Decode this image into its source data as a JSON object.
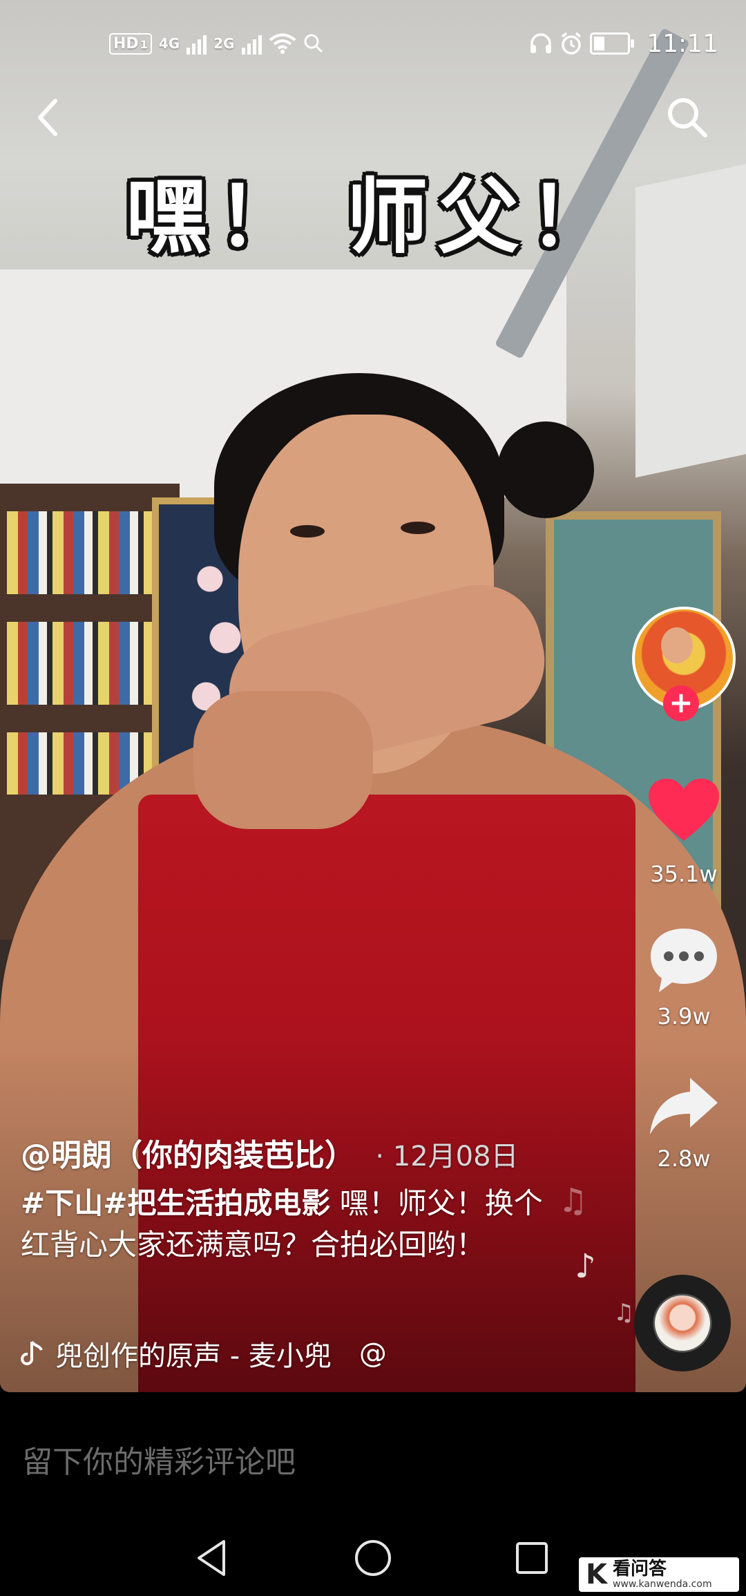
{
  "status_bar": {
    "hd_badge": "HD",
    "hd_sub": "1",
    "net1": "4G",
    "net2": "2G",
    "time": "11:11",
    "battery_level": 0.35
  },
  "video": {
    "caption": "嘿！ 师父！"
  },
  "sidebar": {
    "likes": "35.1w",
    "comments": "3.9w",
    "shares": "2.8w"
  },
  "post": {
    "author": "@明朗（你的肉装芭比）",
    "date": "· 12月08日",
    "hashtags": "#下山#把生活拍成电影",
    "description": " 嘿！师父！换个红背心大家还满意吗？合拍必回哟！",
    "music": "兜创作的原声 - 麦小兜",
    "mention_symbol": "@"
  },
  "comment_bar": {
    "placeholder": "留下你的精彩评论吧"
  },
  "watermark": {
    "logo": "K",
    "title": "看问答",
    "url": "www.kanwenda.com"
  },
  "colors": {
    "like": "#fe2c55",
    "follow": "#fe2c55",
    "shirt": "#b91620"
  },
  "icons": [
    "back-arrow-icon",
    "search-icon",
    "heart-icon",
    "comment-bubble-icon",
    "share-arrow-icon",
    "music-note-icon",
    "nav-back-icon",
    "nav-home-icon",
    "nav-recent-icon"
  ]
}
